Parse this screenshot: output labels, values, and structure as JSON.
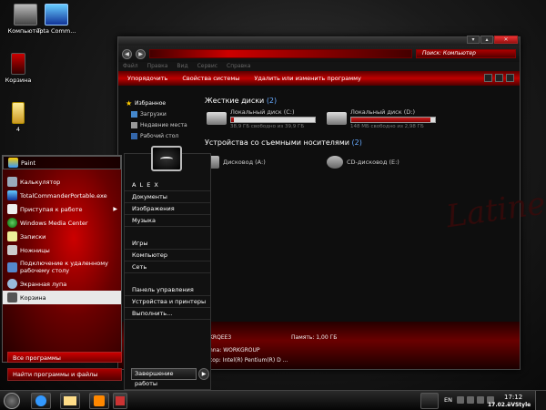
{
  "desktop": {
    "icons": [
      {
        "label": "Компьютер",
        "icon": "computer-icon"
      },
      {
        "label": "Tota Comm...",
        "icon": "floppy-icon"
      },
      {
        "label": "Корзина",
        "icon": "recycle-bin-icon"
      },
      {
        "label": "4",
        "icon": "folder-icon"
      }
    ]
  },
  "explorer": {
    "search_placeholder": "Поиск: Компьютер",
    "menu": [
      "Файл",
      "Правка",
      "Вид",
      "Сервис",
      "Справка"
    ],
    "commands": [
      "Упорядочить",
      "Свойства системы",
      "Удалить или изменить программу"
    ],
    "nav": [
      {
        "label": "Избранное",
        "icon": "star-icon"
      },
      {
        "label": "Загрузки",
        "icon": "downloads-icon"
      },
      {
        "label": "Недавние места",
        "icon": "recent-places-icon"
      },
      {
        "label": "Рабочий стол",
        "icon": "desktop-icon"
      }
    ],
    "hdd_group": {
      "title": "Жесткие диски",
      "count": "(2)"
    },
    "drives": [
      {
        "name": "Локальный диск (C:)",
        "free": "38,9 ГБ свободно из 39,9 ГБ",
        "used_fraction": 0.03
      },
      {
        "name": "Локальный диск (D:)",
        "free": "148 МБ свободно из 2,98 ГБ",
        "used_fraction": 0.95
      }
    ],
    "removable_group": {
      "title": "Устройства со съемными носителями",
      "count": "(2)"
    },
    "removable": [
      {
        "name": "Дисковод (A:)",
        "icon": "floppy-drive-icon"
      },
      {
        "name": "CD-дисковод (E:)",
        "icon": "cd-drive-icon"
      }
    ],
    "details": {
      "computer": "KRQEE3",
      "memory": "Память: 1,00 ГБ",
      "workgroup": "nna: WORKGROUP",
      "cpu": "cop: Intel(R) Pentium(R) D ..."
    },
    "brand_text": "Latineri"
  },
  "start_menu": {
    "pinned": [
      {
        "label": "Paint",
        "icon": "paint-icon"
      }
    ],
    "programs": [
      {
        "label": "Калькулятор",
        "icon": "calculator-icon"
      },
      {
        "label": "TotalCommanderPortable.exe",
        "icon": "floppy-icon"
      },
      {
        "label": "Приступая к работе",
        "icon": "getting-started-icon",
        "arrow": "▶"
      },
      {
        "label": "Windows Media Center",
        "icon": "media-center-icon"
      },
      {
        "label": "Записки",
        "icon": "sticky-notes-icon"
      },
      {
        "label": "Ножницы",
        "icon": "scissors-icon"
      },
      {
        "label": "Подключение к удаленному рабочему столу",
        "icon": "remote-desktop-icon"
      },
      {
        "label": "Экранная лупа",
        "icon": "magnifier-icon"
      }
    ],
    "recycle": {
      "label": "Корзина",
      "icon": "recycle-bin-icon"
    },
    "all_programs": "Все программы",
    "search_placeholder": "Найти программы и файлы",
    "right": {
      "user": "A L E X",
      "items1": [
        "Документы",
        "Изображения",
        "Музыка"
      ],
      "items2": [
        "Игры",
        "Компьютер",
        "Сеть"
      ],
      "items3": [
        "Панель управления",
        "Устройства и принтеры",
        "Выполнить..."
      ]
    },
    "shutdown": "Завершение работы",
    "shutdown_arrow": "▶"
  },
  "taskbar": {
    "lang": "EN",
    "time": "17:12",
    "date": "17.02.ёVStyle"
  }
}
